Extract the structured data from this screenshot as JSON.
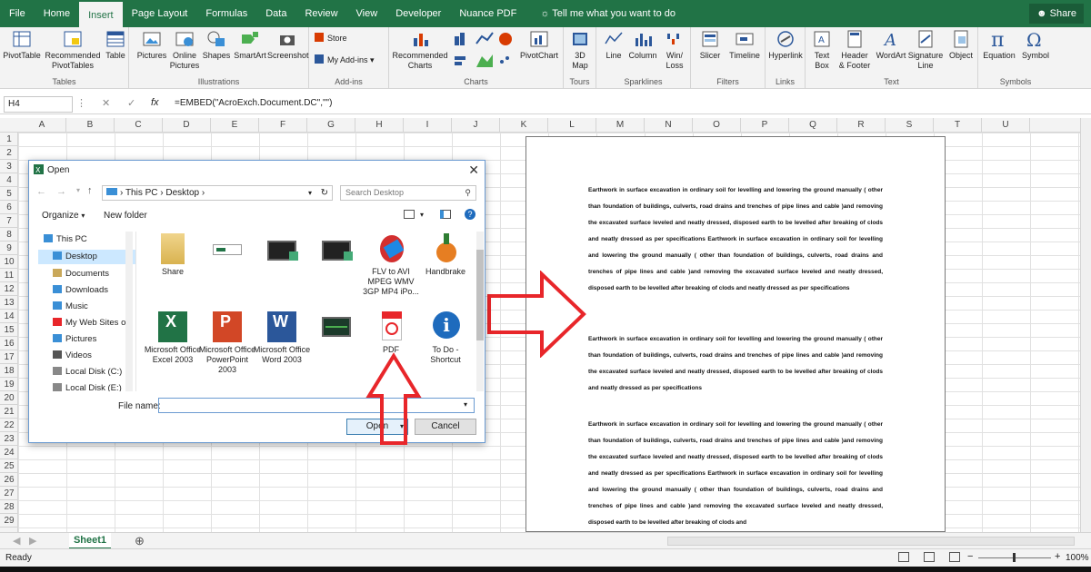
{
  "tabs": [
    "File",
    "Home",
    "Insert",
    "Page Layout",
    "Formulas",
    "Data",
    "Review",
    "View",
    "Developer",
    "Nuance PDF"
  ],
  "active_tab": "Insert",
  "tell_me": "Tell me what you want to do",
  "share_label": "Share",
  "ribbon": {
    "tables": {
      "label": "Tables",
      "buttons": [
        "PivotTable",
        "Recommended\nPivotTables",
        "Table"
      ]
    },
    "illustrations": {
      "label": "Illustrations",
      "buttons": [
        "Pictures",
        "Online\nPictures",
        "Shapes",
        "SmartArt",
        "Screenshot"
      ]
    },
    "addins": {
      "label": "Add-ins",
      "buttons": [
        "Store",
        "My Add-ins"
      ]
    },
    "charts": {
      "label": "Charts",
      "buttons": [
        "Recommended\nCharts",
        "PivotChart"
      ]
    },
    "tours": {
      "label": "Tours",
      "buttons": [
        "3D\nMap"
      ]
    },
    "sparklines": {
      "label": "Sparklines",
      "buttons": [
        "Line",
        "Column",
        "Win/\nLoss"
      ]
    },
    "filters": {
      "label": "Filters",
      "buttons": [
        "Slicer",
        "Timeline"
      ]
    },
    "links": {
      "label": "Links",
      "buttons": [
        "Hyperlink"
      ]
    },
    "text": {
      "label": "Text",
      "buttons": [
        "Text\nBox",
        "Header\n& Footer",
        "WordArt",
        "Signature\nLine",
        "Object"
      ]
    },
    "symbols": {
      "label": "Symbols",
      "buttons": [
        "Equation",
        "Symbol"
      ]
    }
  },
  "name_box": "H4",
  "fx_label": "fx",
  "formula": "=EMBED(\"AcroExch.Document.DC\",\"\")",
  "columns": [
    "A",
    "B",
    "C",
    "D",
    "E",
    "F",
    "G",
    "H",
    "I",
    "J",
    "K",
    "L",
    "M",
    "N",
    "O",
    "P",
    "Q",
    "R",
    "S",
    "T",
    "U"
  ],
  "rows": [
    "1",
    "2",
    "3",
    "4",
    "5",
    "6",
    "7",
    "8",
    "9",
    "10",
    "11",
    "12",
    "13",
    "14",
    "15",
    "16",
    "17",
    "18",
    "19",
    "20",
    "21",
    "22",
    "23",
    "24",
    "25",
    "26",
    "27",
    "28",
    "29"
  ],
  "pdf_paragraphs": [
    "Earthwork in surface excavation in ordinary soil for levelling and lowering the ground manually ( other than foundation of buildings, culverts, road drains and trenches of pipe lines and cable )and removing the excavated surface leveled and neatly dressed, disposed earth to be levelled after breaking of clods and neatly dressed as per specifications Earthwork in surface excavation in ordinary soil for levelling and lowering the ground manually ( other than foundation of buildings, culverts, road drains and trenches of pipe lines and cable )and removing the excavated surface leveled and neatly dressed, disposed earth to be levelled after breaking of clods and neatly dressed as per specifications",
    "Earthwork in surface excavation in ordinary soil for levelling and lowering the ground manually ( other than foundation of buildings, culverts, road drains and trenches of pipe lines and cable )and removing the excavated surface leveled and neatly dressed, disposed earth to be levelled after breaking of clods and neatly dressed as per specifications",
    "Earthwork in surface excavation in ordinary soil for levelling and lowering the ground manually ( other than foundation of buildings, culverts, road drains and trenches of pipe lines and cable )and removing the excavated surface leveled and neatly dressed, disposed earth to be levelled after breaking of clods and neatly dressed as per specifications Earthwork in surface excavation in ordinary soil for levelling and lowering the ground manually ( other than foundation of buildings, culverts, road drains and trenches of pipe lines and cable )and removing the excavated surface leveled and neatly dressed, disposed earth to be levelled after breaking of clods and"
  ],
  "sheet_tab": "Sheet1",
  "status": "Ready",
  "zoom": "100%",
  "dialog": {
    "title": "Open",
    "path": [
      "This PC",
      "Desktop"
    ],
    "search_placeholder": "Search Desktop",
    "organize": "Organize",
    "new_folder": "New folder",
    "tree": [
      "This PC",
      "Desktop",
      "Documents",
      "Downloads",
      "Music",
      "My Web Sites on",
      "Pictures",
      "Videos",
      "Local Disk (C:)",
      "Local Disk (E:)"
    ],
    "files_row1": [
      "Share",
      "",
      "",
      "",
      "FLV to AVI MPEG WMV 3GP MP4 iPo...",
      "Handbrake"
    ],
    "files_row2": [
      "Microsoft Office Excel 2003",
      "Microsoft Office PowerPoint 2003",
      "Microsoft Office Word 2003",
      "",
      "PDF",
      "To Do - Shortcut"
    ],
    "file_name_label": "File name:",
    "file_name_value": "",
    "open_label": "Open",
    "cancel_label": "Cancel"
  },
  "colors": {
    "excel_green": "#217346",
    "arrow_red": "#e8262a"
  }
}
